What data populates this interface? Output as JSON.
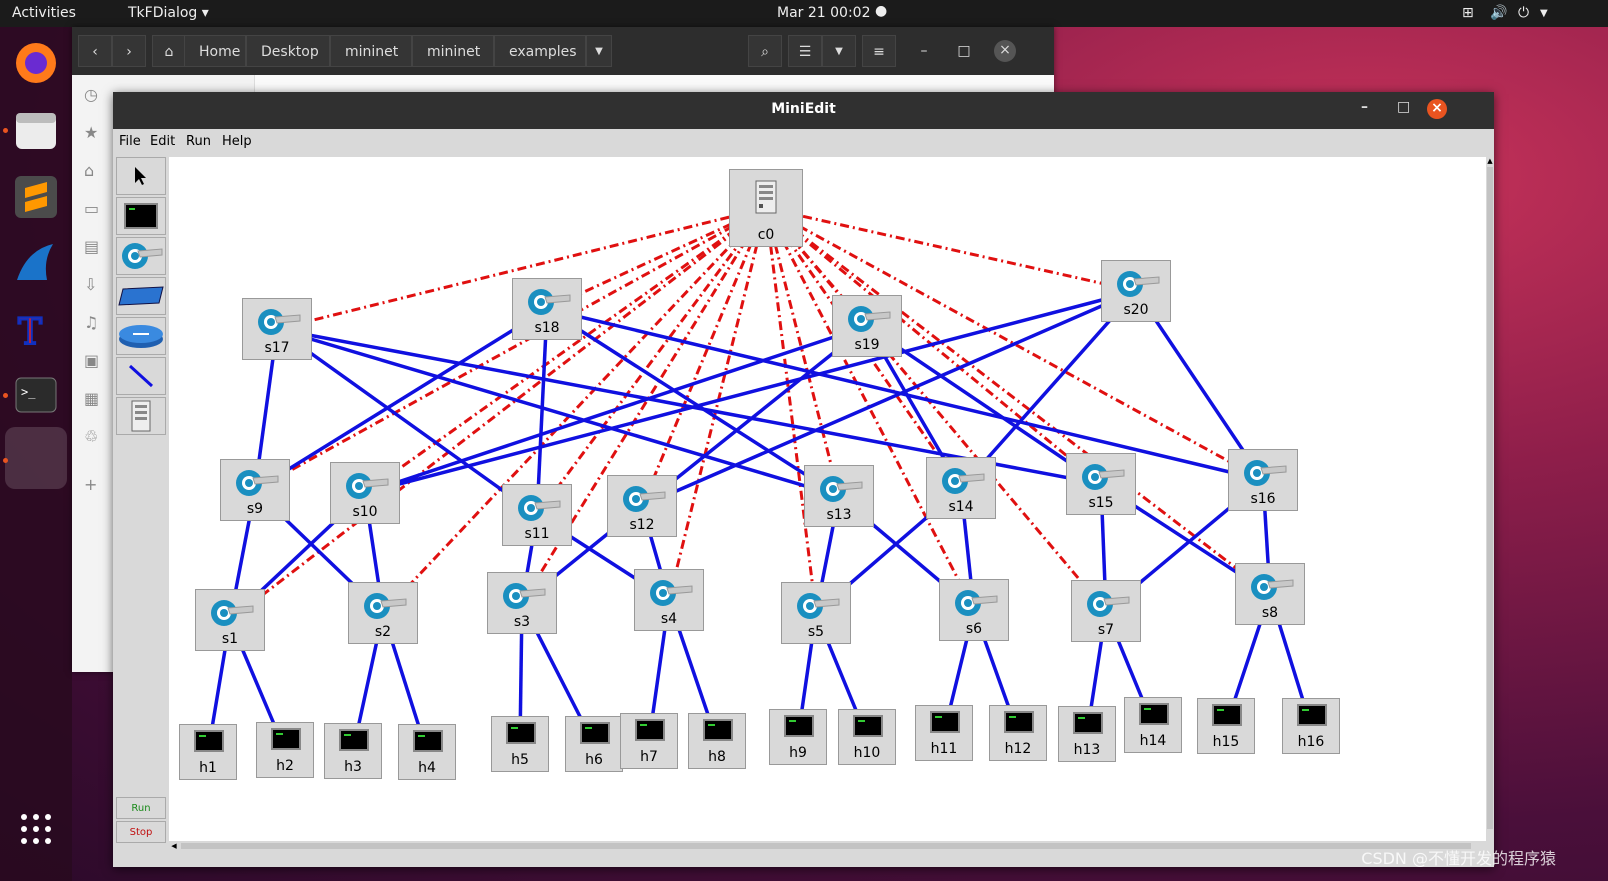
{
  "topbar": {
    "activities": "Activities",
    "app_menu": "TkFDialog ▾",
    "clock": "Mar 21  00:02"
  },
  "files": {
    "breadcrumbs": [
      "Home",
      "Desktop",
      "mininet",
      "mininet",
      "examples"
    ]
  },
  "miniedit": {
    "title": "MiniEdit",
    "menu": [
      "File",
      "Edit",
      "Run",
      "Help"
    ],
    "run_label": "Run",
    "stop_label": "Stop"
  },
  "topology": {
    "controller": "c0",
    "switches": [
      "s1",
      "s2",
      "s3",
      "s4",
      "s5",
      "s6",
      "s7",
      "s8",
      "s9",
      "s10",
      "s11",
      "s12",
      "s13",
      "s14",
      "s15",
      "s16",
      "s17",
      "s18",
      "s19",
      "s20"
    ],
    "hosts": [
      "h1",
      "h2",
      "h3",
      "h4",
      "h5",
      "h6",
      "h7",
      "h8",
      "h9",
      "h10",
      "h11",
      "h12",
      "h13",
      "h14",
      "h15",
      "h16"
    ],
    "links": [
      [
        "s17",
        "s9"
      ],
      [
        "s17",
        "s11"
      ],
      [
        "s17",
        "s13"
      ],
      [
        "s17",
        "s15"
      ],
      [
        "s18",
        "s9"
      ],
      [
        "s18",
        "s11"
      ],
      [
        "s18",
        "s13"
      ],
      [
        "s18",
        "s16"
      ],
      [
        "s19",
        "s10"
      ],
      [
        "s19",
        "s12"
      ],
      [
        "s19",
        "s14"
      ],
      [
        "s19",
        "s15"
      ],
      [
        "s20",
        "s10"
      ],
      [
        "s20",
        "s12"
      ],
      [
        "s20",
        "s14"
      ],
      [
        "s20",
        "s16"
      ],
      [
        "s9",
        "s1"
      ],
      [
        "s9",
        "s2"
      ],
      [
        "s10",
        "s1"
      ],
      [
        "s10",
        "s2"
      ],
      [
        "s11",
        "s3"
      ],
      [
        "s11",
        "s4"
      ],
      [
        "s12",
        "s3"
      ],
      [
        "s12",
        "s4"
      ],
      [
        "s13",
        "s5"
      ],
      [
        "s13",
        "s6"
      ],
      [
        "s14",
        "s5"
      ],
      [
        "s14",
        "s6"
      ],
      [
        "s15",
        "s7"
      ],
      [
        "s15",
        "s8"
      ],
      [
        "s16",
        "s7"
      ],
      [
        "s16",
        "s8"
      ],
      [
        "s1",
        "h1"
      ],
      [
        "s1",
        "h2"
      ],
      [
        "s2",
        "h3"
      ],
      [
        "s2",
        "h4"
      ],
      [
        "s3",
        "h5"
      ],
      [
        "s3",
        "h6"
      ],
      [
        "s4",
        "h7"
      ],
      [
        "s4",
        "h8"
      ],
      [
        "s5",
        "h9"
      ],
      [
        "s5",
        "h10"
      ],
      [
        "s6",
        "h11"
      ],
      [
        "s6",
        "h12"
      ],
      [
        "s7",
        "h13"
      ],
      [
        "s7",
        "h14"
      ],
      [
        "s8",
        "h15"
      ],
      [
        "s8",
        "h16"
      ]
    ]
  },
  "colors": {
    "data_link": "#1010e0",
    "control_link": "#e01010",
    "accent": "#e95420"
  },
  "watermark": "CSDN @不懂开发的程序猿"
}
